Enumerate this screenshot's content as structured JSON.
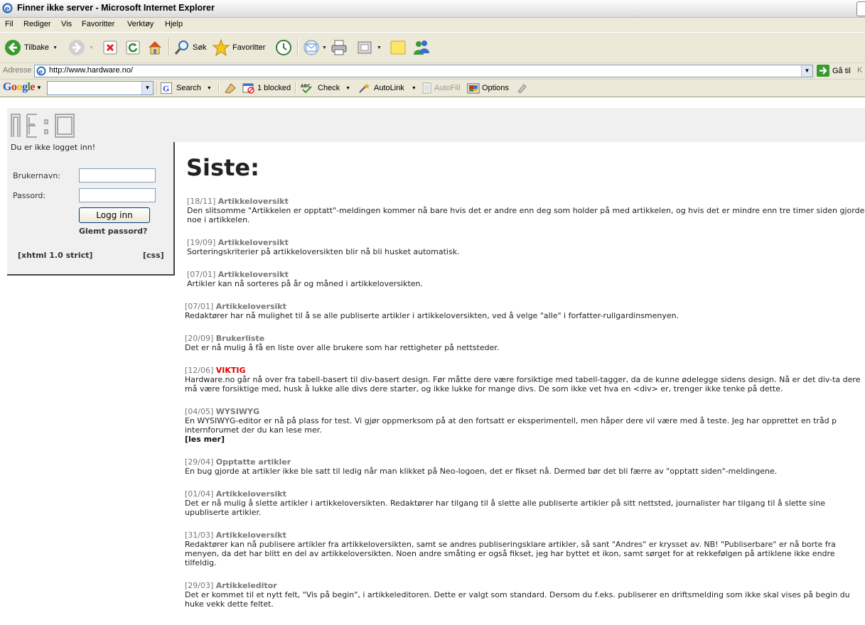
{
  "window": {
    "title": "Finner ikke server - Microsoft Internet Explorer"
  },
  "menu": [
    "Fil",
    "Rediger",
    "Vis",
    "Favoritter",
    "Verktøy",
    "Hjelp"
  ],
  "toolbar": {
    "back": "Tilbake",
    "search": "Søk",
    "favorites": "Favoritter"
  },
  "address": {
    "label": "Adresse",
    "url": "http://www.hardware.no/",
    "go": "Gå til",
    "links": "K"
  },
  "google": {
    "logo": "Google",
    "search": "Search",
    "blocked": "1 blocked",
    "check": "Check",
    "autolink": "AutoLink",
    "autofill": "AutoFill",
    "options": "Options"
  },
  "login": {
    "status": "Du er ikke logget inn!",
    "username_label": "Brukernavn:",
    "password_label": "Passord:",
    "submit": "Logg inn",
    "forgot": "Glemt passord?",
    "xhtml": "[xhtml 1.0 strict]",
    "css": "[css]"
  },
  "main": {
    "heading": "Siste:",
    "news": [
      {
        "date": "[18/11]",
        "title": "Artikkeloversikt",
        "text": "Den slitsomme \"Artikkelen er opptatt\"-meldingen kommer nå bare hvis det er andre enn deg som holder på med artikkelen, og hvis det er mindre enn tre timer siden gjorde noe i artikkelen."
      },
      {
        "date": "[19/09]",
        "title": "Artikkeloversikt",
        "text": "Sorteringskriterier på artikkeloversikten blir nå bli husket automatisk."
      },
      {
        "date": "[07/01]",
        "title": "Artikkeloversikt",
        "text": "Artikler kan nå sorteres på år og måned i artikkeloversikten."
      },
      {
        "date": "[07/01]",
        "title": "Artikkeloversikt",
        "text": "Redaktører har nå mulighet til å se alle publiserte artikler i artikkeloversikten, ved å velge \"alle\" i forfatter-rullgardinsmenyen."
      },
      {
        "date": "[20/09]",
        "title": "Brukerliste",
        "text": "Det er nå mulig å få en liste over alle brukere som har rettigheter på nettsteder."
      },
      {
        "date": "[12/06]",
        "title": "VIKTIG",
        "text": "Hardware.no går nå over fra tabell-basert til div-basert design. Før måtte dere være forsiktige med tabell-tagger, da de kunne ødelegge sidens design. Nå er det div-ta dere må være forsiktige med, husk å lukke alle divs dere starter, og ikke lukke for mange divs. De som ikke vet hva en <div> er, trenger ikke tenke på dette."
      },
      {
        "date": "[04/05]",
        "title": "WYSIWYG",
        "text": "En WYSIWYG-editor er nå på plass for test. Vi gjør oppmerksom på at den fortsatt er eksperimentell, men håper dere vil være med å teste. Jeg har opprettet en tråd p internforumet der du kan lese mer.",
        "more": "[les mer]"
      },
      {
        "date": "[29/04]",
        "title": "Opptatte artikler",
        "text": "En bug gjorde at artikler ikke ble satt til ledig når man klikket på Neo-logoen, det er fikset nå. Dermed bør det bli færre av \"opptatt siden\"-meldingene."
      },
      {
        "date": "[01/04]",
        "title": "Artikkeloversikt",
        "text": "Det er nå mulig å slette artikler i artikkeloversikten. Redaktører har tilgang til å slette alle publiserte artikler på sitt nettsted, journalister har tilgang til å slette sine upubliserte artikler."
      },
      {
        "date": "[31/03]",
        "title": "Artikkeloversikt",
        "text": "Redaktører kan nå publisere artikler fra artikkeloversikten, samt se andres publiseringsklare artikler, så sant \"Andres\" er krysset av. NB! \"Publiserbare\" er nå borte fra menyen, da det har blitt en del av artikkeloversikten. Noen andre småting er også fikset, jeg har byttet et ikon, samt sørget for at rekkefølgen på artiklene ikke endre tilfeldig."
      },
      {
        "date": "[29/03]",
        "title": "Artikkeleditor",
        "text": "Det er kommet til et nytt felt, \"Vis på begin\", i artikkeleditoren. Dette er valgt som standard. Dersom du f.eks. publiserer en driftsmelding som ikke skal vises på begin du huke vekk dette feltet."
      }
    ]
  }
}
